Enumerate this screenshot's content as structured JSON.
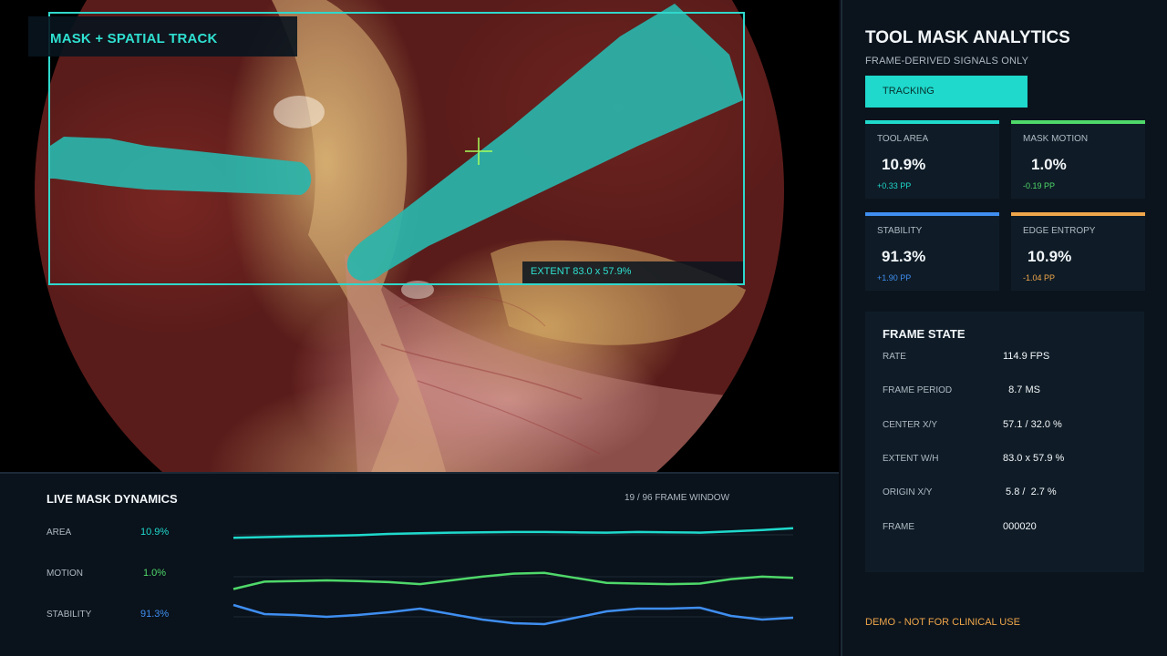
{
  "video": {
    "label": "MASK + SPATIAL TRACK",
    "extent_label": "EXTENT 83.0 x 57.9%",
    "mask_color": "#2ab5ab",
    "box_color": "#2fd8cc"
  },
  "panel": {
    "title": "TOOL MASK ANALYTICS",
    "subtitle": "FRAME-DERIVED SIGNALS ONLY",
    "status": "TRACKING",
    "metrics": [
      {
        "label": "TOOL AREA",
        "value": "10.9%",
        "delta": "+0.33 PP",
        "color": "#1fd9cc"
      },
      {
        "label": "MASK MOTION",
        "value": "1.0%",
        "delta": "-0.19 PP",
        "color": "#4fd86a"
      },
      {
        "label": "STABILITY",
        "value": "91.3%",
        "delta": "+1.90 PP",
        "color": "#3f8ef0"
      },
      {
        "label": "EDGE ENTROPY",
        "value": "10.9%",
        "delta": "-1.04 PP",
        "color": "#f0a64a"
      }
    ],
    "frame_state": {
      "title": "FRAME STATE",
      "rows": [
        {
          "key": "RATE",
          "value": "114.9 FPS"
        },
        {
          "key": "FRAME PERIOD",
          "value": "  8.7 MS"
        },
        {
          "key": "CENTER X/Y",
          "value": "57.1 / 32.0 %"
        },
        {
          "key": "EXTENT W/H",
          "value": "83.0 x 57.9 %"
        },
        {
          "key": "ORIGIN X/Y",
          "value": " 5.8 /  2.7 %"
        },
        {
          "key": "FRAME",
          "value": "000020"
        }
      ]
    },
    "note": "DEMO - NOT FOR CLINICAL USE"
  },
  "dynamics": {
    "title": "LIVE MASK DYNAMICS",
    "window": "19 / 96 FRAME WINDOW",
    "series": [
      {
        "label": "AREA",
        "value": "10.9%",
        "color": "#1fd9cc",
        "values": [
          10.2,
          10.25,
          10.3,
          10.35,
          10.4,
          10.5,
          10.55,
          10.6,
          10.62,
          10.65,
          10.65,
          10.62,
          10.6,
          10.65,
          10.62,
          10.6,
          10.7,
          10.8,
          10.95
        ]
      },
      {
        "label": "MOTION",
        "value": "1.0%",
        "color": "#4fd86a",
        "values": [
          0.7,
          1.0,
          1.02,
          1.05,
          1.02,
          0.98,
          0.9,
          1.05,
          1.2,
          1.32,
          1.35,
          1.15,
          0.95,
          0.92,
          0.9,
          0.92,
          1.1,
          1.2,
          1.15
        ]
      },
      {
        "label": "STABILITY",
        "value": "91.3%",
        "color": "#3f8ef0",
        "values": [
          92.6,
          91.6,
          91.5,
          91.3,
          91.5,
          91.8,
          92.2,
          91.6,
          91.0,
          90.6,
          90.5,
          91.2,
          91.9,
          92.2,
          92.2,
          92.3,
          91.4,
          91.0,
          91.2
        ]
      }
    ]
  }
}
